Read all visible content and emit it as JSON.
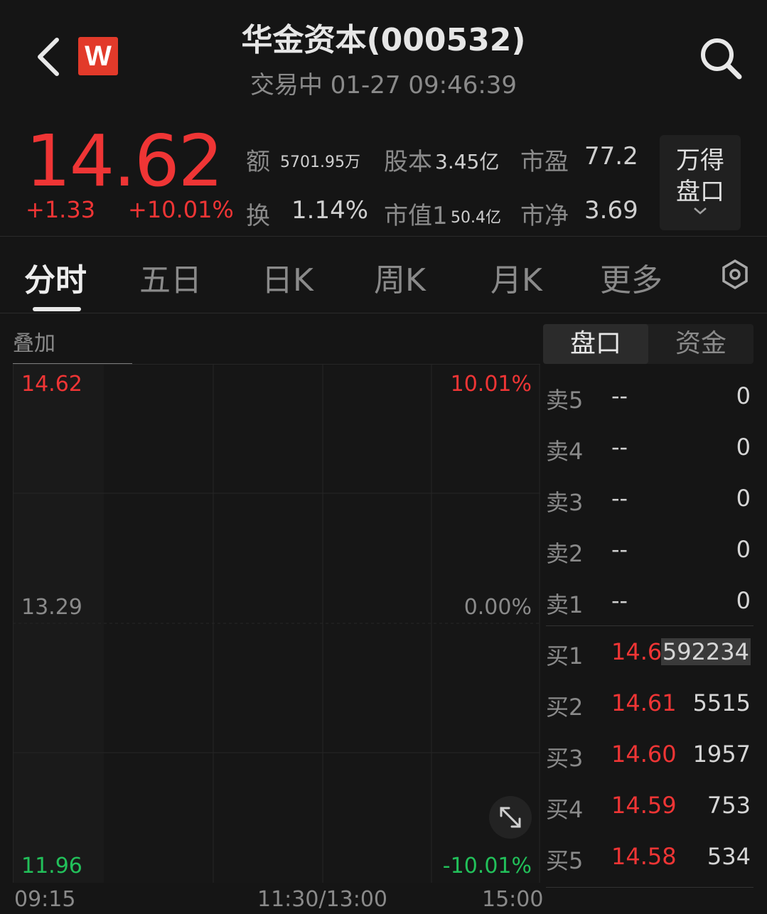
{
  "header": {
    "logo_letter": "W",
    "title": "华金资本(000532)",
    "subtitle": "交易中 01-27 09:46:39"
  },
  "quote": {
    "price": "14.62",
    "change": "+1.33",
    "change_pct": "+10.01%",
    "amount_label": "额",
    "amount_value": "5701.95万",
    "shares_label": "股本",
    "shares_value": "3.45亿",
    "pe_label": "市盈",
    "pe_value": "77.2",
    "turnover_label": "换",
    "turnover_value": "1.14%",
    "mktcap_label": "市值1",
    "mktcap_value": "50.4亿",
    "pb_label": "市净",
    "pb_value": "3.69",
    "wind_line1": "万得",
    "wind_line2": "盘口"
  },
  "tabs": [
    "分时",
    "五日",
    "日K",
    "周K",
    "月K",
    "更多"
  ],
  "chart": {
    "overlay_label": "叠加",
    "y_top": "14.62",
    "y_mid": "13.29",
    "y_bottom": "11.96",
    "pct_top": "10.01%",
    "pct_mid": "0.00%",
    "pct_bottom": "-10.01%",
    "x_start": "09:15",
    "x_mid": "11:30/13:00",
    "x_end": "15:00",
    "colors": {
      "up": "#ef3535",
      "down": "#22c05a",
      "neutral": "#8a8a8a"
    }
  },
  "book": {
    "tab_pankou": "盘口",
    "tab_zijin": "资金",
    "asks": [
      {
        "label": "卖5",
        "price": "--",
        "volume": "0"
      },
      {
        "label": "卖4",
        "price": "--",
        "volume": "0"
      },
      {
        "label": "卖3",
        "price": "--",
        "volume": "0"
      },
      {
        "label": "卖2",
        "price": "--",
        "volume": "0"
      },
      {
        "label": "卖1",
        "price": "--",
        "volume": "0"
      }
    ],
    "bids": [
      {
        "label": "买1",
        "price": "14.62",
        "volume": "592234"
      },
      {
        "label": "买2",
        "price": "14.61",
        "volume": "5515"
      },
      {
        "label": "买3",
        "price": "14.60",
        "volume": "1957"
      },
      {
        "label": "买4",
        "price": "14.59",
        "volume": "753"
      },
      {
        "label": "买5",
        "price": "14.58",
        "volume": "534"
      }
    ]
  }
}
